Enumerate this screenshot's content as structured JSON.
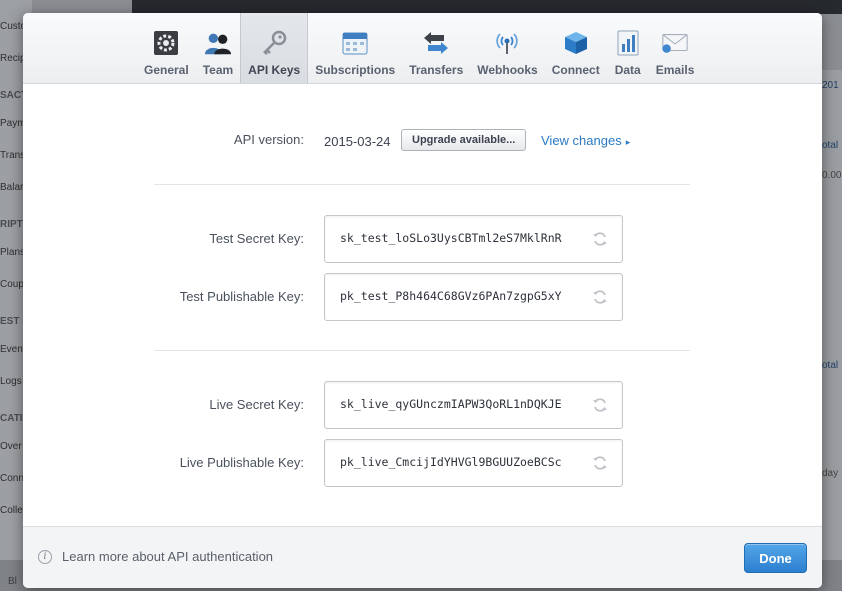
{
  "background": {
    "sidebar_items": [
      "Custo",
      "Recip",
      "SACT",
      "Paym",
      "Trans",
      "Balar",
      "RIPT",
      "Plans",
      "Coup",
      "EST S",
      "Even",
      "Logs",
      "CATI",
      "Over",
      "Conn",
      "Colle"
    ],
    "right_fragments": [
      "201",
      "otal",
      "0.00",
      "otal",
      "day"
    ],
    "bottom_text": "Bl"
  },
  "tabs": [
    {
      "label": "General",
      "icon": "gear-icon"
    },
    {
      "label": "Team",
      "icon": "team-icon"
    },
    {
      "label": "API Keys",
      "icon": "key-icon",
      "active": true
    },
    {
      "label": "Subscriptions",
      "icon": "calendar-icon"
    },
    {
      "label": "Transfers",
      "icon": "transfer-arrows-icon"
    },
    {
      "label": "Webhooks",
      "icon": "webhook-antenna-icon"
    },
    {
      "label": "Connect",
      "icon": "cube-icon"
    },
    {
      "label": "Data",
      "icon": "bar-chart-icon"
    },
    {
      "label": "Emails",
      "icon": "envelope-icon"
    }
  ],
  "api_version": {
    "label": "API version:",
    "value": "2015-03-24",
    "upgrade_label": "Upgrade available...",
    "view_changes_label": "View changes"
  },
  "keys": {
    "test_secret": {
      "label": "Test Secret Key:",
      "value": "sk_test_loSLo3UysCBTml2eS7MklRnR"
    },
    "test_publishable": {
      "label": "Test Publishable Key:",
      "value": "pk_test_P8h464C68GVz6PAn7zgpG5xY"
    },
    "live_secret": {
      "label": "Live Secret Key:",
      "value": "sk_live_qyGUnczmIAPW3QoRL1nDQKJE"
    },
    "live_publishable": {
      "label": "Live Publishable Key:",
      "value": "pk_live_CmcijIdYHVGl9BGUUZoeBCSc"
    }
  },
  "footer": {
    "learn_more": "Learn more about API authentication",
    "done_label": "Done"
  },
  "colors": {
    "link": "#2a7bc4",
    "primary_button": "#2b7fcf"
  }
}
